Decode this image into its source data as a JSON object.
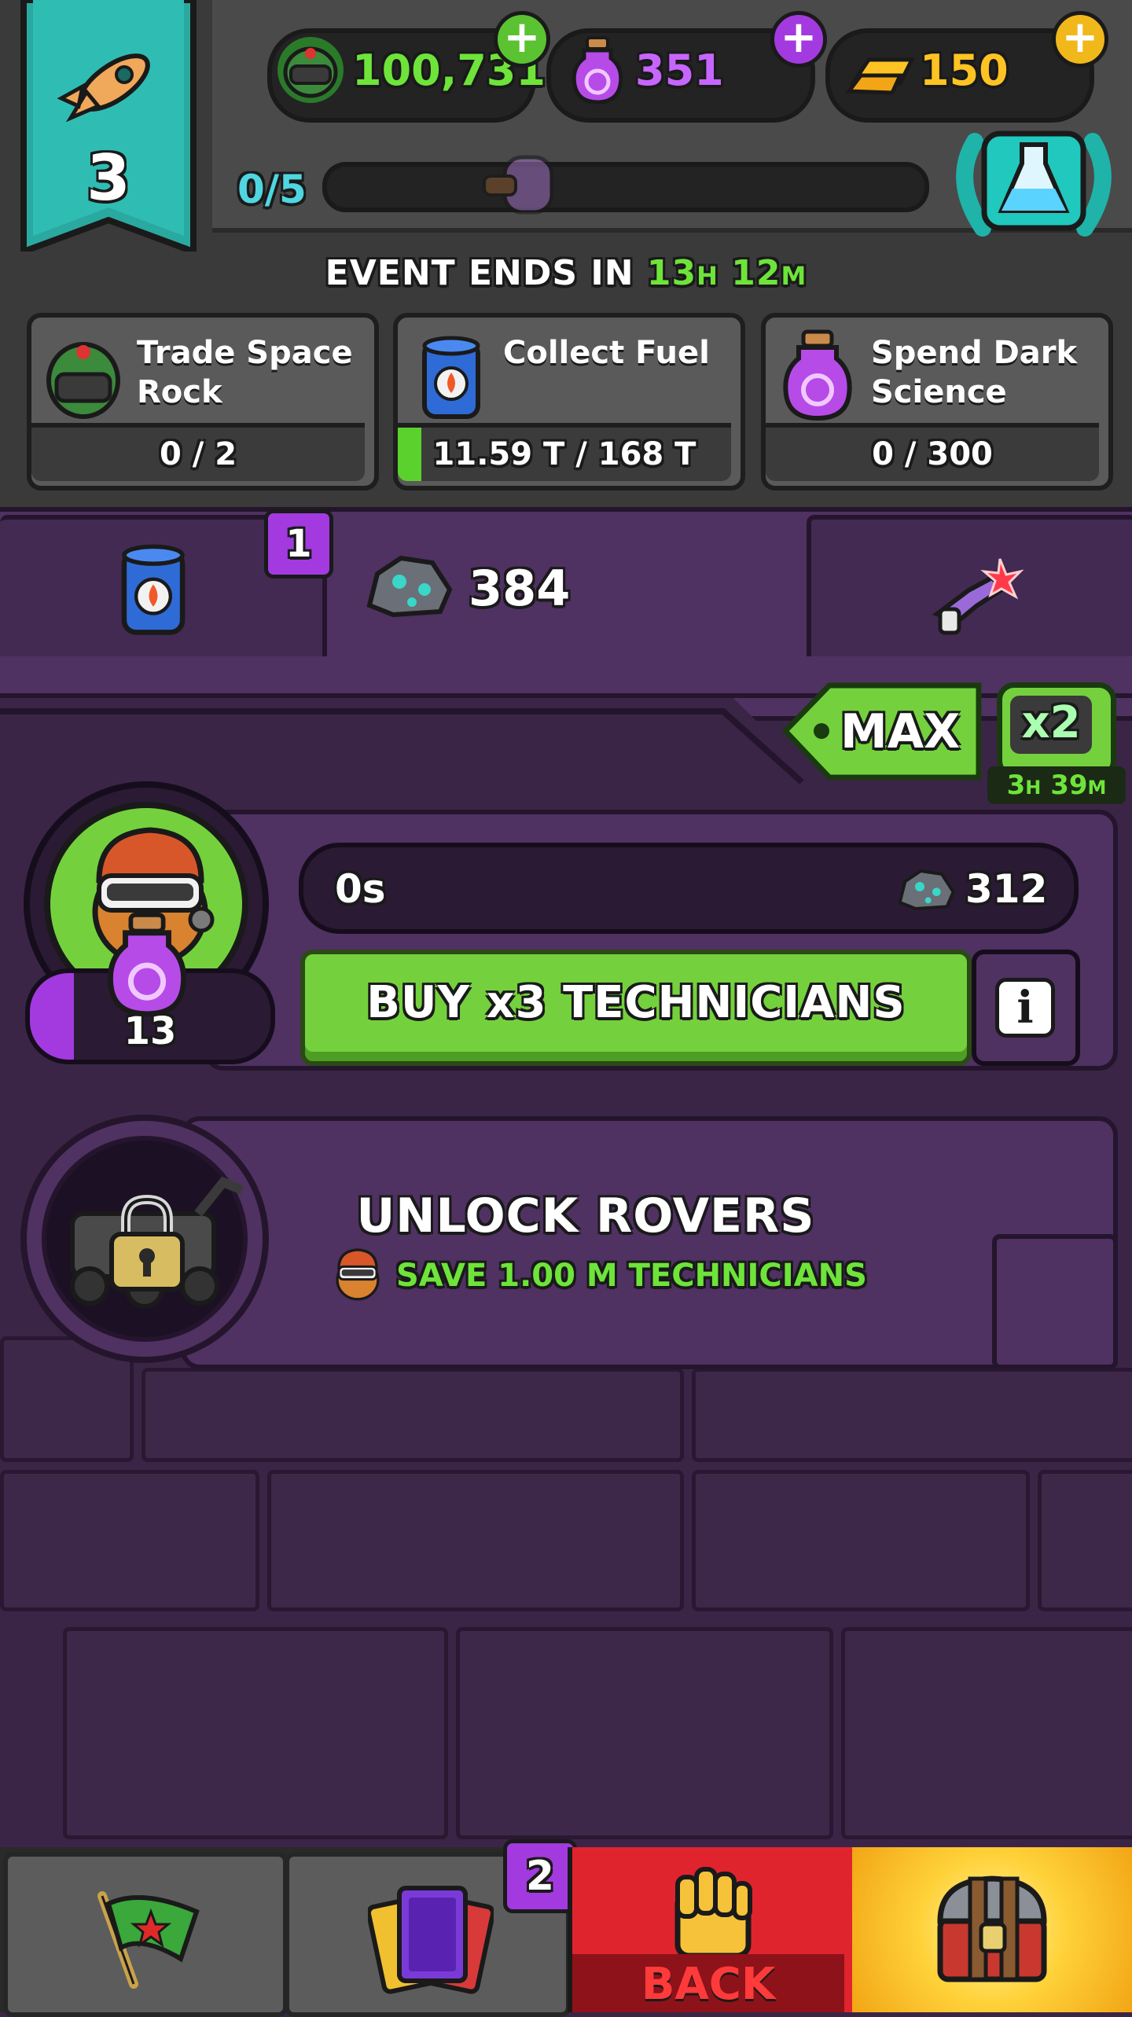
{
  "level": {
    "number": "3",
    "icon": "rocket-icon"
  },
  "currencies": [
    {
      "name": "space-helmet",
      "value": "100,731",
      "color": "#6ee43a",
      "icon": "space-helmet-icon"
    },
    {
      "name": "dark-science",
      "value": "351",
      "color": "#c766ff",
      "icon": "dark-science-flask-icon"
    },
    {
      "name": "gold",
      "value": "150",
      "color": "#ffc423",
      "icon": "gold-bars-icon"
    }
  ],
  "progress": {
    "label": "0/5",
    "fraction": 0.0
  },
  "event": {
    "prefix": "EVENT ENDS IN",
    "hours": "13",
    "hours_unit": "H",
    "minutes": "12",
    "minutes_unit": "M"
  },
  "tasks": [
    {
      "title_line1": "Trade Space",
      "title_line2": "Rock",
      "progress": "0 / 2",
      "fraction": 0.0,
      "icon": "space-helmet-icon"
    },
    {
      "title_line1": "Collect Fuel",
      "title_line2": "",
      "progress": "11.59 T / 168 T",
      "fraction": 0.07,
      "icon": "fuel-can-icon"
    },
    {
      "title_line1": "Spend Dark",
      "title_line2": "Science",
      "progress": "0 / 300",
      "fraction": 0.0,
      "icon": "dark-science-flask-icon"
    }
  ],
  "tabs": {
    "fuel_badge": "1",
    "rock_count": "384"
  },
  "multiplier": {
    "max_label": "MAX",
    "x2_label": "x2",
    "timer_h": "3",
    "timer_m": "39",
    "timer_h_unit": "H",
    "timer_m_unit": "M"
  },
  "technicians": {
    "timer": "0s",
    "cost": "312",
    "buy_label": "BUY x3 TECHNICIANS",
    "owned": "13",
    "info_label": "i"
  },
  "rovers": {
    "title": "UNLOCK ROVERS",
    "requirement": "SAVE 1.00 M TECHNICIANS"
  },
  "bottom_nav": {
    "cards_badge": "2",
    "back_label": "BACK"
  }
}
